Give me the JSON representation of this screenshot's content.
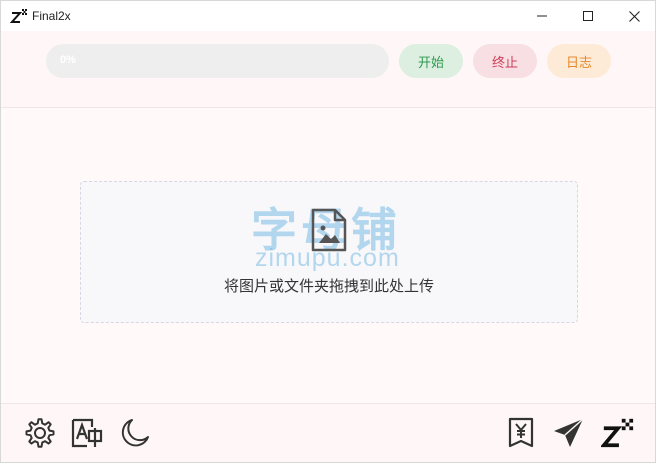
{
  "window": {
    "title": "Final2x",
    "controls": {
      "minimize": "minimize-icon",
      "maximize": "maximize-icon",
      "close": "close-icon"
    }
  },
  "toolbar": {
    "progress": {
      "value": 0,
      "text": "0%"
    },
    "start_label": "开始",
    "stop_label": "终止",
    "log_label": "日志"
  },
  "dropzone": {
    "hint": "将图片或文件夹拖拽到此处上传",
    "icon": "image-file-icon",
    "watermark_cn": "字母铺",
    "watermark_en": "zimupu.com"
  },
  "bottombar": {
    "left_icons": [
      "gear-icon",
      "language-icon",
      "moon-icon"
    ],
    "right_icons": [
      "yen-icon",
      "send-icon",
      "app-logo-icon"
    ]
  },
  "colors": {
    "start": "#2e9a4e",
    "stop": "#cf3d57",
    "log": "#e38a2c",
    "icon": "#333333"
  }
}
